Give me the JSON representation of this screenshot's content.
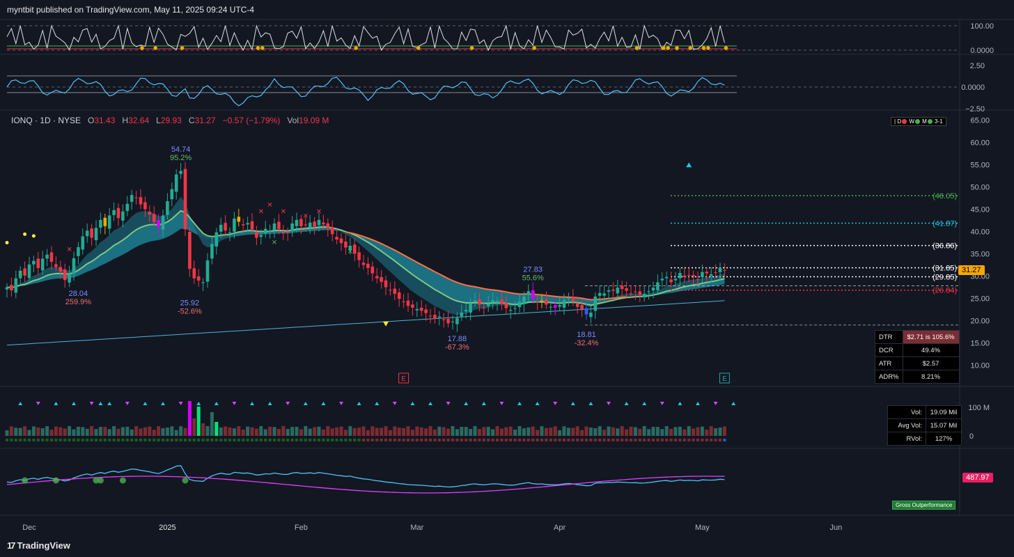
{
  "publication": {
    "text": "myntbit published on TradingView.com, May 11, 2025 09:24 UTC-4"
  },
  "ohlc": {
    "symbol": "IONQ · 1D · NYSE",
    "open_label": "O",
    "open": "31.43",
    "high_label": "H",
    "high": "32.64",
    "low_label": "L",
    "low": "29.93",
    "close_label": "C",
    "close": "31.27",
    "change": "−0.57 (−1.79%)",
    "vol_label": "Vol",
    "vol": "19.09 M"
  },
  "legend_box": {
    "d": "D",
    "w": "W",
    "m": "M",
    "score": "3-1"
  },
  "stats_dtr": {
    "rows": [
      {
        "label": "DTR",
        "value": "$2.71 is 105.6%"
      },
      {
        "label": "DCR",
        "value": "49.4%"
      },
      {
        "label": "ATR",
        "value": "$2.57"
      },
      {
        "label": "ADR%",
        "value": "8.21%"
      }
    ]
  },
  "stats_vol": {
    "rows": [
      {
        "label": "Vol:",
        "value": "19.09 Mil"
      },
      {
        "label": "Avg Vol:",
        "value": "15.07 Mil"
      },
      {
        "label": "RVol:",
        "value": "127%"
      }
    ]
  },
  "price_tag": "31.27",
  "rs_tag": "487.97",
  "gross_label": "Gross Outperformance",
  "brand": "TradingView",
  "chart_data": {
    "type": "candlestick",
    "colors": {
      "up": "#22ab94",
      "down": "#f23645",
      "accent_orange": "#f7a600",
      "purple": "#d500f9",
      "blue": "#2962ff"
    },
    "x_tick_labels": [
      "Dec",
      "2025",
      "Feb",
      "Mar",
      "Apr",
      "May",
      "Jun"
    ],
    "price_axis": {
      "ticks": [
        "65.00",
        "60.00",
        "55.00",
        "50.00",
        "45.00",
        "40.00",
        "35.00",
        "30.00",
        "25.00",
        "20.00",
        "15.00",
        "10.00"
      ],
      "range": [
        10,
        65
      ]
    },
    "osc1_axis": {
      "ticks": [
        "100.00",
        "0.0000"
      ],
      "range": [
        0,
        100
      ]
    },
    "osc2_axis": {
      "ticks": [
        "2.50",
        "0.0000",
        "−2.50"
      ],
      "range": [
        -2.5,
        2.5
      ]
    },
    "volume_axis": {
      "ticks": [
        "100 M",
        "0"
      ]
    },
    "levels": [
      {
        "label": "(48.05)",
        "value": 48.05,
        "color": "#4caf50"
      },
      {
        "label": "(41.87)",
        "value": 41.87,
        "color": "#26c6da"
      },
      {
        "label": "(36.86)",
        "value": 36.86,
        "color": "#ffffff"
      },
      {
        "label": "(31.85)",
        "value": 31.85,
        "color": "#ffffff"
      },
      {
        "label": "(29.85)",
        "value": 29.85,
        "color": "#ffffff"
      },
      {
        "label": "(26.84)",
        "value": 26.84,
        "color": "#f23645"
      }
    ],
    "annotations": [
      {
        "label": "54.74",
        "pct": "95.2%",
        "day": 39,
        "price": 54.74,
        "pos": "above"
      },
      {
        "label": "28.04",
        "pct": "259.9%",
        "day": 16,
        "price": 28.04,
        "pos": "below"
      },
      {
        "label": "25.92",
        "pct": "-52.6%",
        "day": 41,
        "price": 25.92,
        "pos": "below"
      },
      {
        "label": "17.88",
        "pct": "-67.3%",
        "day": 101,
        "price": 17.88,
        "pos": "below"
      },
      {
        "label": "27.83",
        "pct": "55.6%",
        "day": 118,
        "price": 27.83,
        "pos": "above"
      },
      {
        "label": "18.81",
        "pct": "-32.4%",
        "day": 130,
        "price": 18.81,
        "pos": "below"
      }
    ],
    "earnings_markers": [
      {
        "label": "E",
        "day": 89,
        "color": "#f23645"
      },
      {
        "label": "E",
        "day": 161,
        "color": "#26a69a"
      }
    ],
    "closes": [
      27.5,
      26.8,
      29.5,
      31.2,
      30.1,
      32.6,
      33.4,
      31.8,
      33.9,
      34.8,
      33.2,
      32.0,
      31.0,
      29.1,
      30.5,
      34.0,
      36.5,
      38.9,
      40.2,
      38.6,
      40.8,
      42.6,
      41.2,
      43.6,
      44.8,
      43.0,
      44.5,
      46.2,
      48.2,
      47.6,
      46.1,
      45.0,
      43.8,
      42.1,
      41.0,
      43.6,
      46.8,
      49.5,
      52.8,
      53.6,
      40.5,
      31.6,
      29.5,
      29.0,
      28.6,
      33.5,
      37.2,
      39.8,
      41.5,
      40.2,
      39.8,
      42.9,
      42.2,
      41.4,
      41.9,
      40.5,
      38.6,
      39.2,
      40.6,
      40.1,
      41.8,
      40.5,
      39.6,
      39.7,
      41.8,
      42.6,
      41.2,
      41.4,
      42.0,
      41.1,
      42.6,
      41.6,
      40.6,
      39.4,
      38.2,
      37.4,
      36.4,
      36.8,
      35.0,
      33.6,
      32.5,
      31.8,
      30.6,
      29.5,
      28.7,
      27.5,
      26.9,
      26.0,
      24.9,
      24.2,
      23.3,
      22.9,
      22.6,
      22.2,
      21.7,
      21.0,
      20.4,
      20.9,
      20.1,
      19.4,
      19.8,
      20.6,
      21.8,
      22.4,
      23.9,
      24.5,
      23.6,
      22.9,
      23.8,
      24.6,
      24.4,
      23.7,
      22.8,
      22.4,
      22.8,
      24.3,
      25.4,
      26.6,
      24.9,
      24.1,
      24.5,
      23.6,
      23.1,
      22.9,
      23.5,
      24.6,
      25.1,
      24.4,
      23.1,
      22.6,
      21.4,
      21.8,
      25.4,
      26.2,
      26.1,
      26.8,
      26.7,
      27.4,
      27.1,
      26.7,
      26.1,
      26.4,
      25.8,
      26.0,
      26.6,
      27.4,
      28.6,
      29.4,
      29.8,
      28.6,
      29.4,
      30.7,
      29.8,
      30.1,
      29.9,
      29.3,
      30.9,
      30.6,
      30.4,
      30.8,
      31.9,
      31.27
    ]
  }
}
